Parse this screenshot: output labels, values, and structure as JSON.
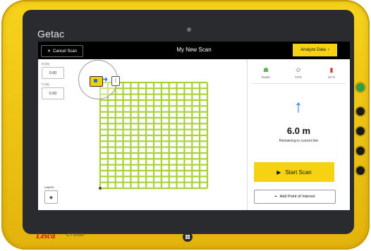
{
  "device": {
    "brand": "Getac",
    "logo": "Leica",
    "model": "CT1000"
  },
  "topbar": {
    "cancel_label": "Cancel Scan",
    "title": "My New Scan",
    "analyze_label": "Analyze Data"
  },
  "left": {
    "x_label": "X (m)",
    "x_value": "0.00",
    "y_label": "Y (m)",
    "y_value": "0.00",
    "layers_label": "Layers"
  },
  "status": [
    {
      "label": "Radar",
      "icon": "radar-icon",
      "color": "#5bb55b"
    },
    {
      "label": "GPS",
      "icon": "gps-icon",
      "color": "#9a9a9a"
    },
    {
      "label": "26 %",
      "icon": "battery-icon",
      "color": "#e0381f"
    }
  ],
  "guidance": {
    "distance": "6.0 m",
    "subtitle": "Remaining in current line"
  },
  "actions": {
    "start_label": "Start Scan",
    "poi_label": "Add Point of Interest"
  },
  "colors": {
    "accent": "#f5d312",
    "grid": "#a9d13a",
    "arrow": "#1f78e0",
    "logo": "#c8101e"
  }
}
